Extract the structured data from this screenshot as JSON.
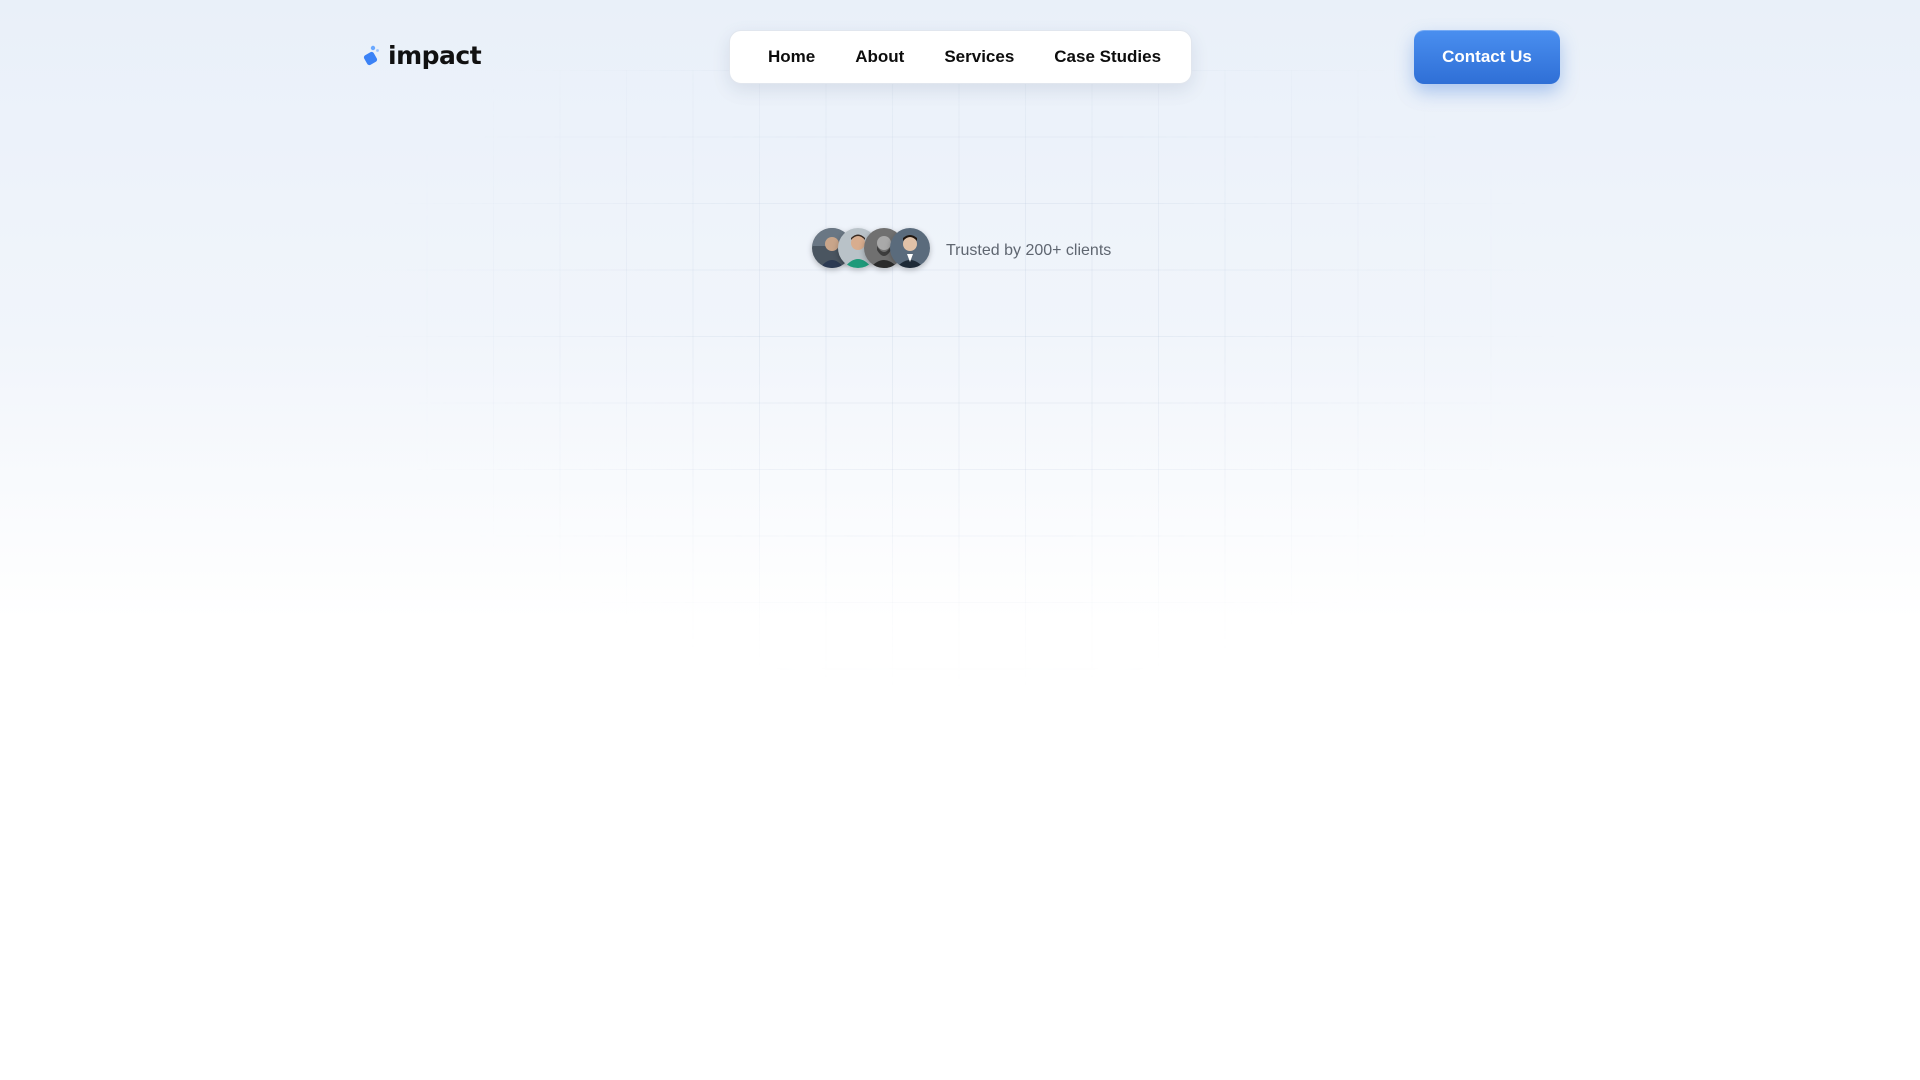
{
  "brand": {
    "name": "impact",
    "accent_color": "#3b82f6"
  },
  "nav": {
    "items": [
      {
        "label": "Home"
      },
      {
        "label": "About"
      },
      {
        "label": "Services"
      },
      {
        "label": "Case Studies"
      }
    ]
  },
  "header": {
    "cta_label": "Contact Us",
    "cta_color": "#3a7de6"
  },
  "hero": {
    "trust_text": "Trusted by 200+ clients",
    "avatars": [
      {
        "name": "client-avatar-1"
      },
      {
        "name": "client-avatar-2"
      },
      {
        "name": "client-avatar-3"
      },
      {
        "name": "client-avatar-4"
      }
    ]
  }
}
